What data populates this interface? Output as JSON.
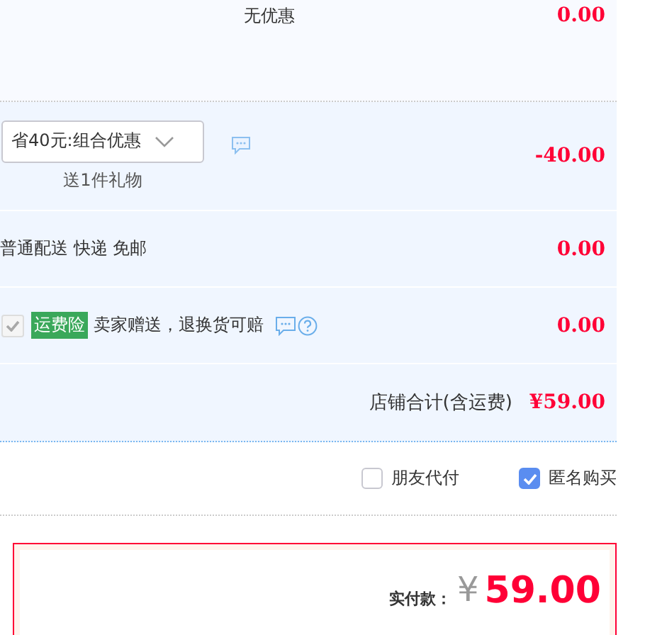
{
  "promotion": {
    "label": "无优惠",
    "amount": "0.00"
  },
  "combo": {
    "selection": "省40元:组合优惠",
    "gift": "送1件礼物",
    "amount": "-40.00"
  },
  "delivery": {
    "label": "普通配送 快递 免邮",
    "amount": "0.00"
  },
  "insurance": {
    "checked": true,
    "disabled": true,
    "tag": "运费险",
    "text": "卖家赠送，退换货可赔",
    "amount": "0.00"
  },
  "store_total": {
    "label": "店铺合计(含运费)",
    "amount": "¥59.00"
  },
  "options": [
    {
      "label": "朋友代付",
      "checked": false
    },
    {
      "label": "匿名购买",
      "checked": true
    }
  ],
  "payment": {
    "label": "实付款：",
    "currency": "¥",
    "amount": "59.00"
  }
}
